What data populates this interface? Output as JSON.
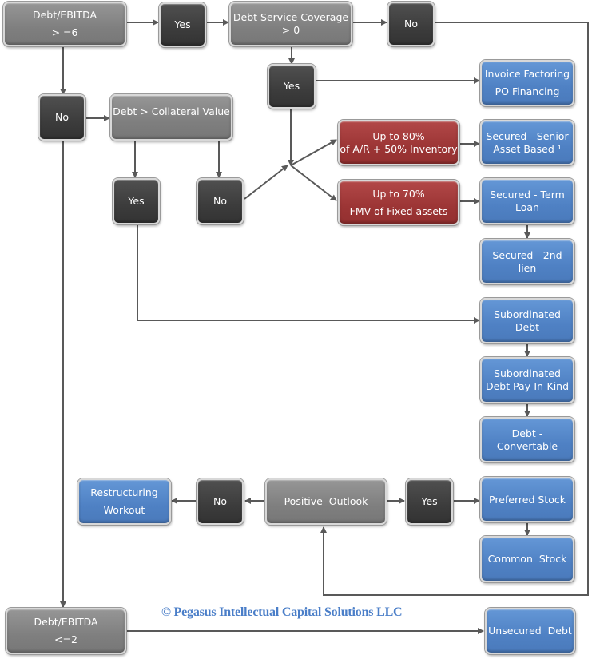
{
  "diagram": {
    "nodes": {
      "debt_ebitda_high": {
        "line1": "Debt/EBITDA",
        "line2": "> =6"
      },
      "yes_top": {
        "label": "Yes"
      },
      "dscr": {
        "line1": "Debt Service Coverage",
        "line2": "> 0"
      },
      "no_top": {
        "label": "No"
      },
      "yes_dscr": {
        "label": "Yes"
      },
      "invoice_factoring": {
        "line1": "Invoice Factoring",
        "line2": "PO Financing"
      },
      "no_left": {
        "label": "No"
      },
      "debt_collateral": {
        "label": "Debt > Collateral Value"
      },
      "yes_collateral": {
        "label": "Yes"
      },
      "no_collateral": {
        "label": "No"
      },
      "ar_inventory": {
        "line1": "Up to 80%",
        "line2": "of A/R + 50% Inventory"
      },
      "secured_senior": {
        "line1": "Secured - Senior",
        "line2": "Asset Based ¹"
      },
      "fixed_assets": {
        "line1": "Up to 70%",
        "line2": "FMV of Fixed assets"
      },
      "secured_term": {
        "line1": "Secured - Term",
        "line2": "Loan"
      },
      "secured_2nd": {
        "line1": "Secured - 2nd",
        "line2": "lien"
      },
      "subordinated": {
        "line1": "Subordinated",
        "line2": "Debt"
      },
      "subordinated_pik": {
        "line1": "Subordinated",
        "line2": "Debt Pay-In-Kind"
      },
      "convertible": {
        "line1": "Debt -",
        "line2": "Convertable"
      },
      "restructuring": {
        "line1": "Restructuring",
        "line2": "Workout"
      },
      "no_outlook": {
        "label": "No"
      },
      "positive_outlook": {
        "label": "Positive  Outlook"
      },
      "yes_outlook": {
        "label": "Yes"
      },
      "preferred_stock": {
        "label": "Preferred Stock"
      },
      "common_stock": {
        "label": "Common  Stock"
      },
      "debt_ebitda_low": {
        "line1": "Debt/EBITDA",
        "line2": "<=2"
      },
      "unsecured_debt": {
        "label": "Unsecured  Debt"
      }
    },
    "copyright": "© Pegasus Intellectual Capital Solutions LLC",
    "colors": {
      "decision": "#7f7f7f",
      "answer": "#3c3c3c",
      "outcome": "#4f81c4",
      "limit": "#9c3535",
      "connector": "#595959",
      "copyright": "#4a7ec8"
    }
  }
}
